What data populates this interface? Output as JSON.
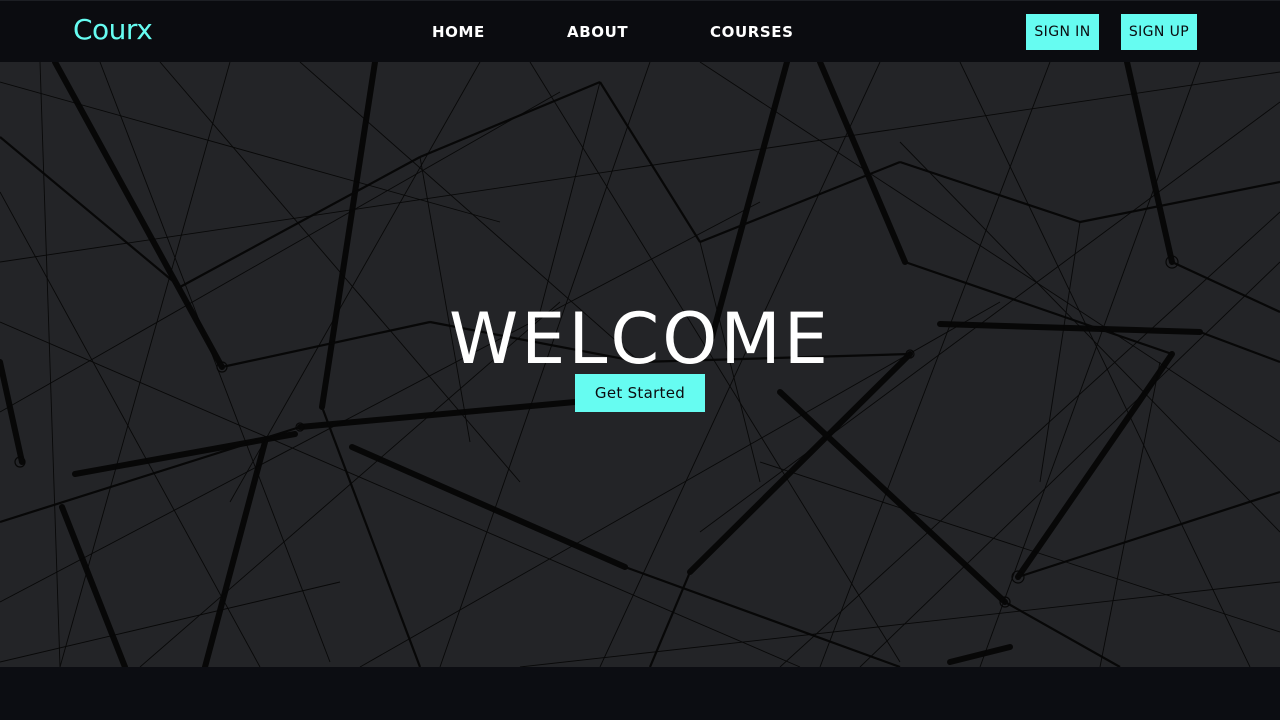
{
  "brand": {
    "name": "Courx",
    "accent_color": "#66fcf1"
  },
  "nav": {
    "links": [
      {
        "label": "HOME"
      },
      {
        "label": "ABOUT"
      },
      {
        "label": "COURSES"
      }
    ],
    "sign_in_label": "SIGN IN",
    "sign_up_label": "SIGN UP"
  },
  "hero": {
    "title": "WELCOME",
    "cta_label": "Get Started",
    "background_image": "network-lines"
  },
  "colors": {
    "nav_bg": "#0b0c10",
    "hero_bg": "#232427",
    "text": "#ffffff"
  }
}
